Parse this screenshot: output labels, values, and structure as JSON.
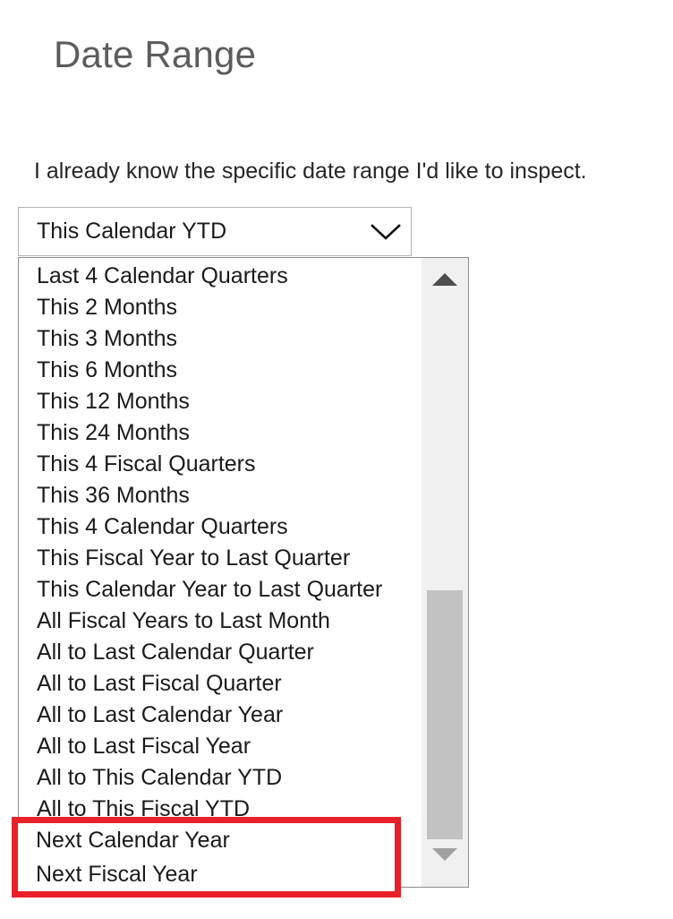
{
  "page": {
    "title": "Date Range",
    "intro": "I already know the specific date range I'd like to inspect."
  },
  "combobox": {
    "selected_value": "This Calendar YTD",
    "chevron_icon": "chevron-down-icon",
    "expanded": true
  },
  "dropdown": {
    "options": [
      "Last 4 Calendar Quarters",
      "This 2 Months",
      "This 3 Months",
      "This 6 Months",
      "This 12 Months",
      "This 24 Months",
      "This 4 Fiscal Quarters",
      "This 36 Months",
      "This 4 Calendar Quarters",
      "This Fiscal Year to Last Quarter",
      "This Calendar Year to Last Quarter",
      "All Fiscal Years to Last Month",
      "All to Last Calendar Quarter",
      "All to Last Fiscal Quarter",
      "All to Last Calendar Year",
      "All to Last Fiscal Year",
      "All to This Calendar YTD",
      "All to This Fiscal YTD"
    ],
    "highlighted_options": [
      "Next Calendar Year",
      "Next Fiscal Year"
    ],
    "scrollbar": {
      "up_arrow_icon": "scroll-up-arrow-icon",
      "down_arrow_icon": "scroll-down-arrow-icon",
      "thumb_position_percent": 57,
      "thumb_size_percent": 43
    }
  },
  "annotation": {
    "highlight_color": "#e8202a"
  },
  "colors": {
    "title": "#5c5c5c",
    "body_text": "#262626",
    "option_text": "#1a1a1a",
    "panel_border": "#8c8c8c",
    "combobox_border": "#b3b3b3",
    "scrollbar_track": "#f0f0f0",
    "scrollbar_thumb": "#c2c2c2",
    "scroll_up_arrow": "#4d4d4d",
    "scroll_down_arrow": "#a0a0a0"
  }
}
